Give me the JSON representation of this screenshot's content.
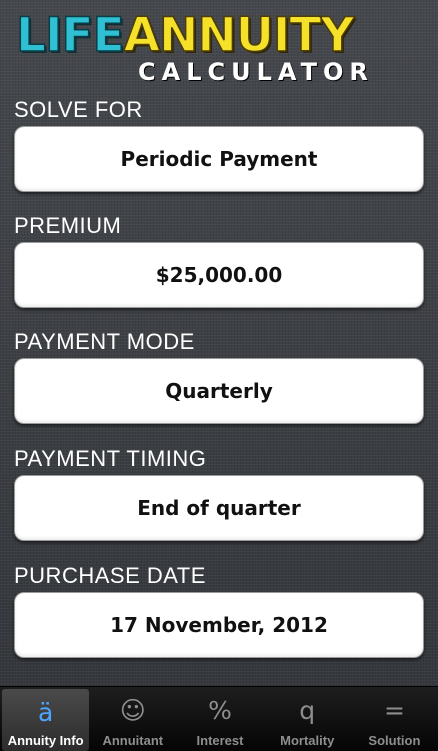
{
  "header": {
    "logo_life": "LIFE",
    "logo_annuity": "ANNUITY",
    "logo_calculator": "CALCULATOR"
  },
  "fields": [
    {
      "label": "SOLVE FOR",
      "value": "Periodic Payment"
    },
    {
      "label": "PREMIUM",
      "value": "$25,000.00"
    },
    {
      "label": "PAYMENT MODE",
      "value": "Quarterly"
    },
    {
      "label": "PAYMENT TIMING",
      "value": "End of quarter"
    },
    {
      "label": "PURCHASE DATE",
      "value": "17 November, 2012"
    }
  ],
  "tabs": [
    {
      "icon": "ä",
      "label": "Annuity Info",
      "active": true
    },
    {
      "icon": "☺",
      "label": "Annuitant",
      "active": false
    },
    {
      "icon": "%",
      "label": "Interest",
      "active": false
    },
    {
      "icon": "q",
      "label": "Mortality",
      "active": false
    },
    {
      "icon": "=",
      "label": "Solution",
      "active": false
    }
  ],
  "colors": {
    "accent_blue": "#4ea5ff",
    "logo_cyan": "#2fc1d3",
    "logo_yellow": "#f6e12a"
  }
}
